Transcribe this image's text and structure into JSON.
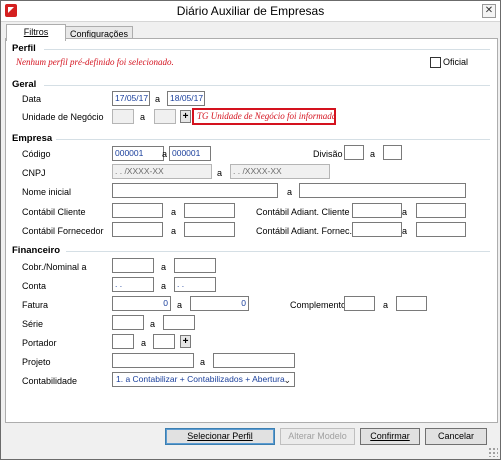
{
  "window": {
    "title": "Diário Auxiliar de Empresas"
  },
  "tabs": [
    {
      "label": "Filtros",
      "active": true
    },
    {
      "label": "Configurações",
      "active": false
    }
  ],
  "perfil": {
    "title": "Perfil",
    "message": "Nenhum perfil pré-definido foi selecionado.",
    "oficial_label": "Oficial",
    "oficial_checked": false
  },
  "geral": {
    "title": "Geral",
    "data_label": "Data",
    "data_from": "17/05/17",
    "a": "a",
    "data_to": "18/05/17",
    "unidade_label": "Unidade de Negócio",
    "unidade_from": "",
    "unidade_to": "",
    "unidade_plus": "+",
    "unidade_warning": "TG Unidade de Negócio foi informada."
  },
  "empresa": {
    "title": "Empresa",
    "codigo_label": "Código",
    "codigo_from": "000001",
    "codigo_to": "000001",
    "divisao_label": "Divisão",
    "divisao_from": "",
    "divisao_to": "",
    "cnpj_label": "CNPJ",
    "cnpj_from": ".   .   /XXXX-XX",
    "cnpj_to": ".   .   /XXXX-XX",
    "nome_label": "Nome inicial",
    "contabil_cliente_label": "Contábil Cliente",
    "contabil_adiant_cliente_label": "Contábil Adiant. Cliente",
    "contabil_fornecedor_label": "Contábil Fornecedor",
    "contabil_adiant_fornec_label": "Contábil Adiant. Fornec."
  },
  "financeiro": {
    "title": "Financeiro",
    "cobr_label": "Cobr./Nominal a",
    "conta_label": "Conta",
    "conta_from": ". .",
    "conta_to": ". .",
    "fatura_label": "Fatura",
    "fatura_from": "0",
    "fatura_to": "0",
    "complemento_label": "Complemento",
    "serie_label": "Série",
    "portador_label": "Portador",
    "portador_plus": "+",
    "projeto_label": "Projeto",
    "contabilidade_label": "Contabilidade",
    "contabilidade_value": "1. a Contabilizar + Contabilizados  + Abertura"
  },
  "buttons": {
    "selecionar_perfil": "Selecionar Perfil",
    "alterar_modelo": "Alterar Modelo",
    "confirmar": "Confirmar",
    "cancelar": "Cancelar"
  }
}
